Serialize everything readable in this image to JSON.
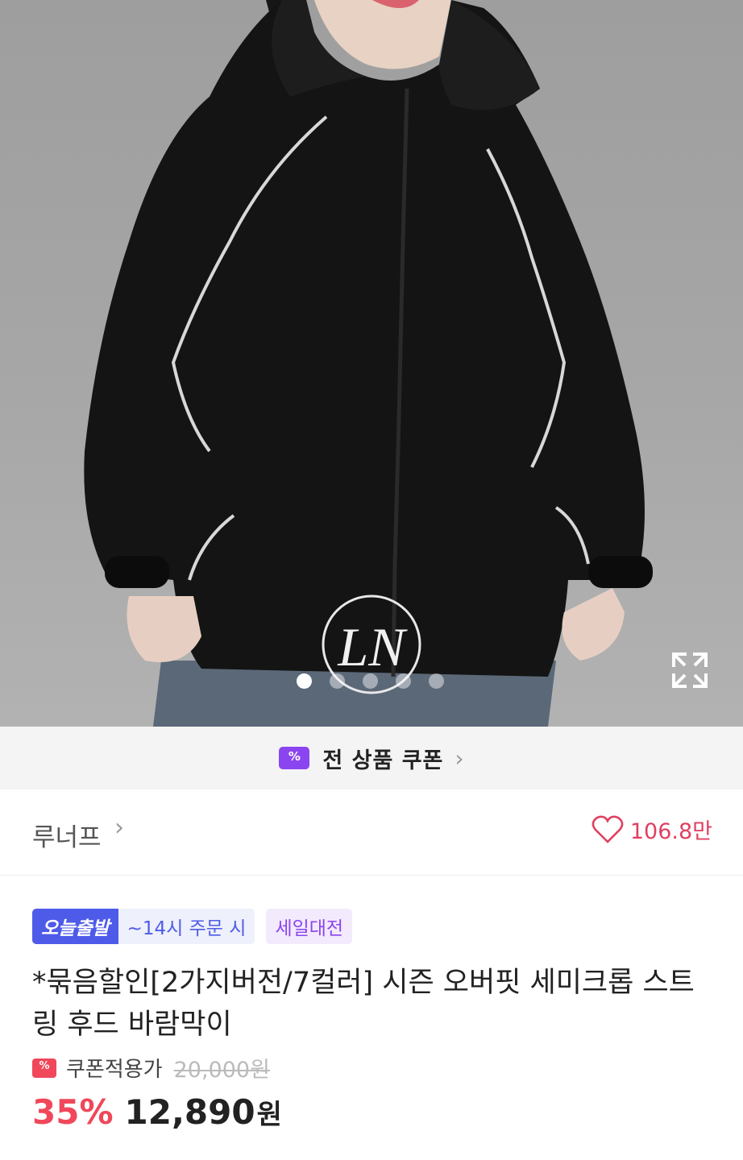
{
  "coupon_banner": {
    "label": "전 상품 쿠폰"
  },
  "store": {
    "name": "루너프",
    "likes": "106.8만"
  },
  "badges": {
    "today": "오늘출발",
    "order_cutoff": "~14시 주문 시",
    "sale_event": "세일대전"
  },
  "product": {
    "title": "*묶음할인[2가지버전/7컬러] 시즌 오버핏 세미크롭 스트링 후드 바람막이",
    "coupon_price_label": "쿠폰적용가",
    "original_price": "20,000원",
    "discount": "35%",
    "final_price": "12,890",
    "currency": "원"
  },
  "carousel": {
    "count": 5,
    "active_index": 0
  },
  "logo": {
    "text": "LN"
  },
  "colors": {
    "accent_purple": "#8b45f0",
    "sale_red": "#f0475a",
    "badge_blue": "#4e5be9",
    "heart": "#e04060"
  }
}
